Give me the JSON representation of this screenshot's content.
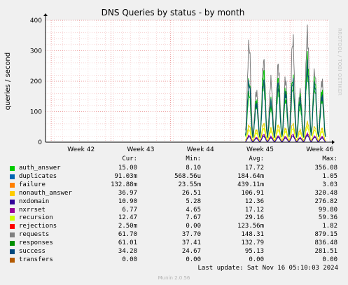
{
  "chart_data": {
    "type": "line",
    "title": "DNS Queries by status - by month",
    "ylabel": "queries / second",
    "xlabel": "",
    "ylim": [
      0,
      400
    ],
    "yticks": [
      0,
      100,
      200,
      300,
      400
    ],
    "xticks": [
      "Week 42",
      "Week 43",
      "Week 44",
      "Week 45",
      "Week 46"
    ],
    "grid": true,
    "data_start_fraction": 0.705,
    "series": [
      {
        "name": "requests",
        "color": "#7f7f7f",
        "peaks": [
          320,
          165,
          265,
          200,
          250,
          205,
          335,
          165,
          355,
          230,
          200
        ]
      },
      {
        "name": "responses",
        "color": "#00c000",
        "peaks": [
          200,
          135,
          230,
          135,
          205,
          170,
          210,
          150,
          275,
          205,
          165
        ]
      },
      {
        "name": "auth_answer",
        "color": "#00cc00",
        "peaks": [
          160,
          120,
          190,
          115,
          170,
          140,
          180,
          120,
          230,
          175,
          140
        ]
      },
      {
        "name": "success",
        "color": "#004e6e",
        "peaks": [
          195,
          125,
          200,
          130,
          190,
          160,
          200,
          140,
          250,
          190,
          150
        ]
      },
      {
        "name": "nonauth_answer",
        "color": "#e5ce00",
        "peaks": [
          55,
          40,
          60,
          45,
          55,
          45,
          60,
          40,
          65,
          50,
          45
        ]
      },
      {
        "name": "recursion",
        "color": "#e5ff00",
        "peaks": [
          40,
          30,
          45,
          35,
          40,
          35,
          45,
          30,
          50,
          40,
          35
        ]
      },
      {
        "name": "nxrrset",
        "color": "#990099",
        "peaks": [
          22,
          15,
          25,
          18,
          20,
          18,
          25,
          15,
          28,
          20,
          18
        ]
      },
      {
        "name": "nxdomain",
        "color": "#2a00a0",
        "peaks": [
          18,
          12,
          20,
          14,
          16,
          14,
          20,
          12,
          22,
          16,
          14
        ]
      }
    ]
  },
  "legend": {
    "headers": {
      "cur": "Cur:",
      "min": "Min:",
      "avg": "Avg:",
      "max": "Max:"
    },
    "rows": [
      {
        "name": "auth_answer",
        "color": "#00cc00",
        "cur": "15.00",
        "min": "8.10",
        "avg": "17.72",
        "max": "356.08"
      },
      {
        "name": "duplicates",
        "color": "#0066b3",
        "cur": "91.03m",
        "min": "568.56u",
        "avg": "184.64m",
        "max": "1.05"
      },
      {
        "name": "failure",
        "color": "#ff8000",
        "cur": "132.88m",
        "min": "23.55m",
        "avg": "439.11m",
        "max": "3.03"
      },
      {
        "name": "nonauth_answer",
        "color": "#ffcc00",
        "cur": "36.97",
        "min": "26.51",
        "avg": "106.91",
        "max": "320.48"
      },
      {
        "name": "nxdomain",
        "color": "#330099",
        "cur": "10.90",
        "min": "5.28",
        "avg": "12.36",
        "max": "276.82"
      },
      {
        "name": "nxrrset",
        "color": "#990099",
        "cur": "6.77",
        "min": "4.65",
        "avg": "17.12",
        "max": "99.80"
      },
      {
        "name": "recursion",
        "color": "#ccff00",
        "cur": "12.47",
        "min": "7.67",
        "avg": "29.16",
        "max": "59.36"
      },
      {
        "name": "rejections",
        "color": "#ff0000",
        "cur": "2.50m",
        "min": "0.00",
        "avg": "123.56m",
        "max": "1.82"
      },
      {
        "name": "requests",
        "color": "#808080",
        "cur": "61.70",
        "min": "37.70",
        "avg": "148.31",
        "max": "879.15"
      },
      {
        "name": "responses",
        "color": "#008f00",
        "cur": "61.01",
        "min": "37.41",
        "avg": "132.79",
        "max": "836.48"
      },
      {
        "name": "success",
        "color": "#00487d",
        "cur": "34.28",
        "min": "24.67",
        "avg": "95.13",
        "max": "281.51"
      },
      {
        "name": "transfers",
        "color": "#b35a00",
        "cur": "0.00",
        "min": "0.00",
        "avg": "0.00",
        "max": "0.00"
      }
    ]
  },
  "last_update": "Last update: Sat Nov 16 05:10:03 2024",
  "munin_version": "Munin 2.0.56",
  "side_label": "RRDTOOL / TOBI OETIKER"
}
